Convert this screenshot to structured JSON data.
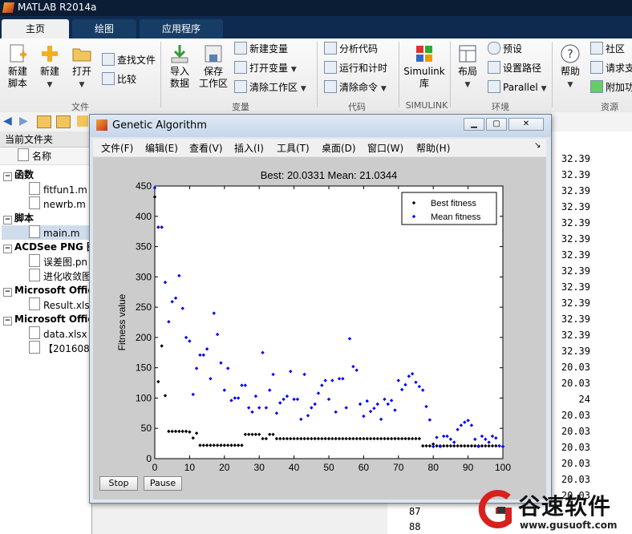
{
  "app": {
    "title": "MATLAB R2014a"
  },
  "tabs": [
    "主页",
    "绘图",
    "应用程序"
  ],
  "ribbon": {
    "file": {
      "new_script": "新建\n脚本",
      "new": "新建",
      "open": "打开",
      "find_files": "查找文件",
      "compare": "比较",
      "group": "文件"
    },
    "variable": {
      "import": "导入\n数据",
      "save_ws": "保存\n工作区",
      "new_var": "新建变量",
      "open_var": "打开变量",
      "clear_ws": "清除工作区",
      "group": "变量"
    },
    "code": {
      "analyze": "分析代码",
      "run_time": "运行和计时",
      "clear_cmd": "清除命令",
      "group": "代码"
    },
    "simulink": {
      "lib": "Simulink\n库",
      "group": "SIMULINK"
    },
    "env": {
      "layout": "布局",
      "prefs": "预设",
      "set_path": "设置路径",
      "parallel": "Parallel",
      "group": "环境"
    },
    "resources": {
      "help": "帮助",
      "community": "社区",
      "request": "请求支",
      "addons": "附加功",
      "group": "资源"
    }
  },
  "left_panel": {
    "header": "当前文件夹",
    "name_col": "名称",
    "sections": [
      {
        "label": "函数",
        "items": [
          "fitfun1.m",
          "newrb.m"
        ]
      },
      {
        "label": "脚本",
        "items": [
          "main.m"
        ]
      },
      {
        "label": "ACDSee PNG 图",
        "items": [
          "误差图.pn",
          "进化收敛图"
        ]
      },
      {
        "label": "Microsoft Offic",
        "items": [
          "Result.xls"
        ]
      },
      {
        "label": "Microsoft Offic",
        "items": [
          "data.xlsx",
          "【201608"
        ]
      }
    ]
  },
  "right_values": [
    "32.39",
    "32.39",
    "32.39",
    "32.39",
    "32.39",
    "32.39",
    "32.39",
    "32.39",
    "32.39",
    "32.39",
    "32.39",
    "32.39",
    "32.39",
    "20.03",
    "20.03",
    "24",
    "20.03",
    "20.03",
    "20.03",
    "20.03",
    "20.03",
    "20.03"
  ],
  "bottom_numbers": [
    "87",
    "88"
  ],
  "figure": {
    "title": "Genetic Algorithm",
    "menu": [
      "文件(F)",
      "编辑(E)",
      "查看(V)",
      "插入(I)",
      "工具(T)",
      "桌面(D)",
      "窗口(W)",
      "帮助(H)"
    ],
    "stop_label": "Stop",
    "pause_label": "Pause"
  },
  "watermark": {
    "text": "谷速软件",
    "url": "www.gusuoft.com"
  },
  "chart_data": {
    "type": "scatter",
    "title": "Best: 20.0331 Mean: 21.0344",
    "xlabel": "Generation",
    "ylabel": "Fitness value",
    "xlim": [
      0,
      100
    ],
    "ylim": [
      0,
      450
    ],
    "xticks": [
      0,
      10,
      20,
      30,
      40,
      50,
      60,
      70,
      80,
      90,
      100
    ],
    "yticks": [
      0,
      50,
      100,
      150,
      200,
      250,
      300,
      350,
      400,
      450
    ],
    "legend_position": "top-right",
    "series": [
      {
        "name": "Best fitness",
        "color": "#000000",
        "x": [
          0,
          1,
          2,
          3,
          4,
          5,
          6,
          7,
          8,
          9,
          10,
          11,
          12,
          13,
          14,
          15,
          16,
          17,
          18,
          19,
          20,
          21,
          22,
          23,
          24,
          25,
          26,
          27,
          28,
          29,
          30,
          31,
          32,
          33,
          34,
          35,
          36,
          37,
          38,
          39,
          40,
          41,
          42,
          43,
          44,
          45,
          46,
          47,
          48,
          49,
          50,
          51,
          52,
          53,
          54,
          55,
          56,
          57,
          58,
          59,
          60,
          61,
          62,
          63,
          64,
          65,
          66,
          67,
          68,
          69,
          70,
          71,
          72,
          73,
          74,
          75,
          76,
          77,
          78,
          79,
          80,
          81,
          82,
          83,
          84,
          85,
          86,
          87,
          88,
          89,
          90,
          91,
          92,
          93,
          94,
          95,
          96,
          97,
          98,
          99,
          100
        ],
        "y": [
          432,
          127,
          186,
          104,
          45,
          45,
          45,
          45,
          45,
          45,
          44,
          34,
          42,
          22,
          22,
          22,
          22,
          22,
          22,
          22,
          22,
          22,
          22,
          22,
          22,
          22,
          40,
          40,
          40,
          40,
          40,
          33,
          33,
          40,
          40,
          33,
          33,
          33,
          33,
          33,
          33,
          33,
          33,
          33,
          33,
          33,
          33,
          33,
          33,
          33,
          33,
          33,
          33,
          33,
          33,
          33,
          33,
          33,
          33,
          33,
          33,
          33,
          33,
          33,
          33,
          33,
          33,
          33,
          33,
          33,
          33,
          33,
          33,
          33,
          33,
          33,
          33,
          21,
          21,
          21,
          24,
          21,
          21,
          21,
          21,
          21,
          21,
          21,
          21,
          21,
          21,
          21,
          21,
          21,
          21,
          21,
          21,
          21,
          21,
          21,
          20
        ]
      },
      {
        "name": "Mean fitness",
        "color": "#0000ff",
        "x": [
          0,
          1,
          2,
          3,
          4,
          5,
          6,
          7,
          8,
          9,
          10,
          11,
          12,
          13,
          14,
          15,
          16,
          17,
          18,
          19,
          20,
          21,
          22,
          23,
          24,
          25,
          26,
          27,
          28,
          29,
          30,
          31,
          32,
          33,
          34,
          35,
          36,
          37,
          38,
          39,
          40,
          41,
          42,
          43,
          44,
          45,
          46,
          47,
          48,
          49,
          50,
          51,
          52,
          53,
          54,
          55,
          56,
          57,
          58,
          59,
          60,
          61,
          62,
          63,
          64,
          65,
          66,
          67,
          68,
          69,
          70,
          71,
          72,
          73,
          74,
          75,
          76,
          77,
          78,
          79,
          80,
          81,
          82,
          83,
          84,
          85,
          86,
          87,
          88,
          89,
          90,
          91,
          92,
          93,
          94,
          95,
          96,
          97,
          98,
          99,
          100
        ],
        "y": [
          447,
          382,
          382,
          291,
          226,
          259,
          265,
          302,
          248,
          200,
          194,
          106,
          149,
          171,
          171,
          181,
          132,
          240,
          205,
          158,
          113,
          149,
          96,
          100,
          100,
          121,
          121,
          84,
          77,
          103,
          84,
          175,
          84,
          113,
          139,
          75,
          92,
          98,
          103,
          144,
          98,
          98,
          65,
          139,
          71,
          84,
          90,
          108,
          121,
          129,
          98,
          129,
          77,
          132,
          132,
          84,
          198,
          152,
          146,
          90,
          70,
          95,
          78,
          83,
          90,
          65,
          98,
          90,
          96,
          80,
          129,
          114,
          122,
          136,
          140,
          126,
          119,
          113,
          86,
          64,
          20,
          35,
          20,
          37,
          37,
          32,
          27,
          48,
          55,
          60,
          63,
          55,
          32,
          20,
          37,
          32,
          27,
          37,
          34,
          21,
          20
        ]
      }
    ]
  }
}
